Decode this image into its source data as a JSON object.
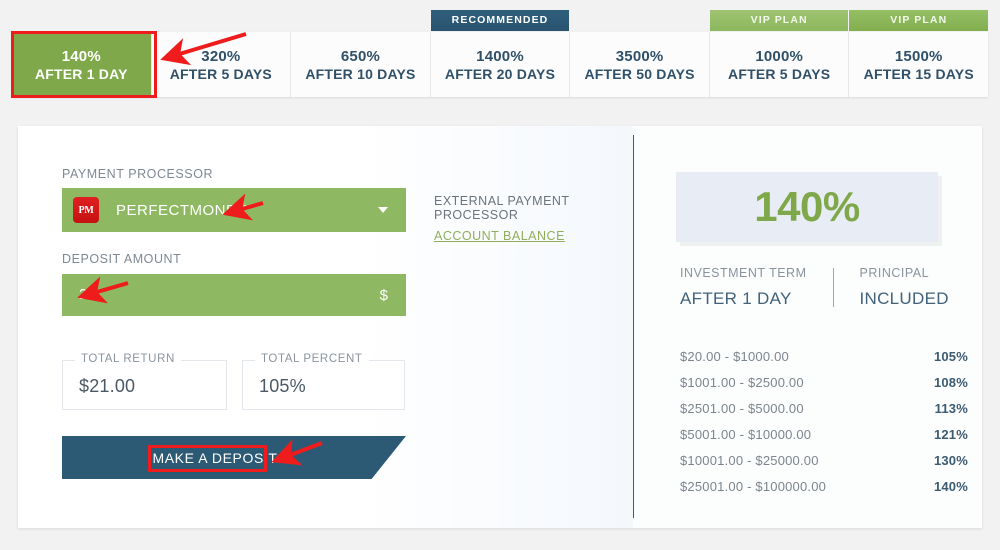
{
  "colors": {
    "accent_green": "#7fa84a",
    "field_green": "#8fb863",
    "deep_blue": "#2c5a75",
    "annotation_red": "#ee1c1c",
    "panel_blue": "#e7ecf5"
  },
  "plans": {
    "tabs": [
      {
        "percent": "140%",
        "term": "AFTER 1 DAY",
        "badge": "",
        "active": true
      },
      {
        "percent": "320%",
        "term": "AFTER 5 DAYS",
        "badge": "",
        "active": false
      },
      {
        "percent": "650%",
        "term": "AFTER 10 DAYS",
        "badge": "",
        "active": false
      },
      {
        "percent": "1400%",
        "term": "AFTER 20 DAYS",
        "badge": "RECOMMENDED",
        "active": false
      },
      {
        "percent": "3500%",
        "term": "AFTER 50 DAYS",
        "badge": "",
        "active": false
      },
      {
        "percent": "1000%",
        "term": "AFTER 5 DAYS",
        "badge": "VIP PLAN",
        "active": false
      },
      {
        "percent": "1500%",
        "term": "AFTER 15 DAYS",
        "badge": "VIP PLAN",
        "active": false
      }
    ]
  },
  "form": {
    "processor_label": "PAYMENT PROCESSOR",
    "processor_value": "PERFECTMONEY",
    "processor_icon_text": "PM",
    "processor_icon_name": "perfectmoney-icon",
    "caret_icon_name": "chevron-down-icon",
    "amount_label": "DEPOSIT AMOUNT",
    "amount_value": "20",
    "amount_currency": "$",
    "external_title": "EXTERNAL PAYMENT PROCESSOR",
    "external_link": "ACCOUNT BALANCE",
    "total_return_label": "TOTAL RETURN",
    "total_return_value": "$21.00",
    "total_percent_label": "TOTAL PERCENT",
    "total_percent_value": "105%",
    "deposit_button_label": "MAKE A DEPOSIT"
  },
  "summary": {
    "rate": "140%",
    "investment_term_label": "INVESTMENT TERM",
    "investment_term_value": "AFTER 1 DAY",
    "principal_label": "PRINCIPAL",
    "principal_value": "INCLUDED",
    "tiers": [
      {
        "range": "$20.00 - $1000.00",
        "percent": "105%"
      },
      {
        "range": "$1001.00 - $2500.00",
        "percent": "108%"
      },
      {
        "range": "$2501.00 - $5000.00",
        "percent": "113%"
      },
      {
        "range": "$5001.00 - $10000.00",
        "percent": "121%"
      },
      {
        "range": "$10001.00 - $25000.00",
        "percent": "130%"
      },
      {
        "range": "$25001.00 - $100000.00",
        "percent": "140%"
      }
    ]
  }
}
